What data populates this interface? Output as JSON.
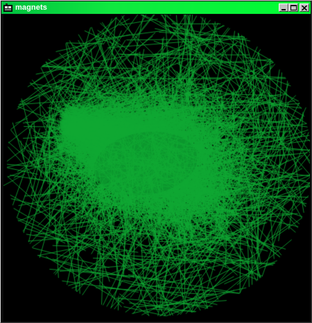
{
  "window": {
    "title": "magnets",
    "icon": "app-window-icon",
    "controls": {
      "minimize_icon": "minimize-icon",
      "maximize_icon": "maximize-icon",
      "close_icon": "close-icon"
    }
  },
  "colors": {
    "titlebar_start": "#00c040",
    "titlebar_end": "#00ff33",
    "canvas_background": "#000000",
    "line_color": "#0fa833"
  }
}
